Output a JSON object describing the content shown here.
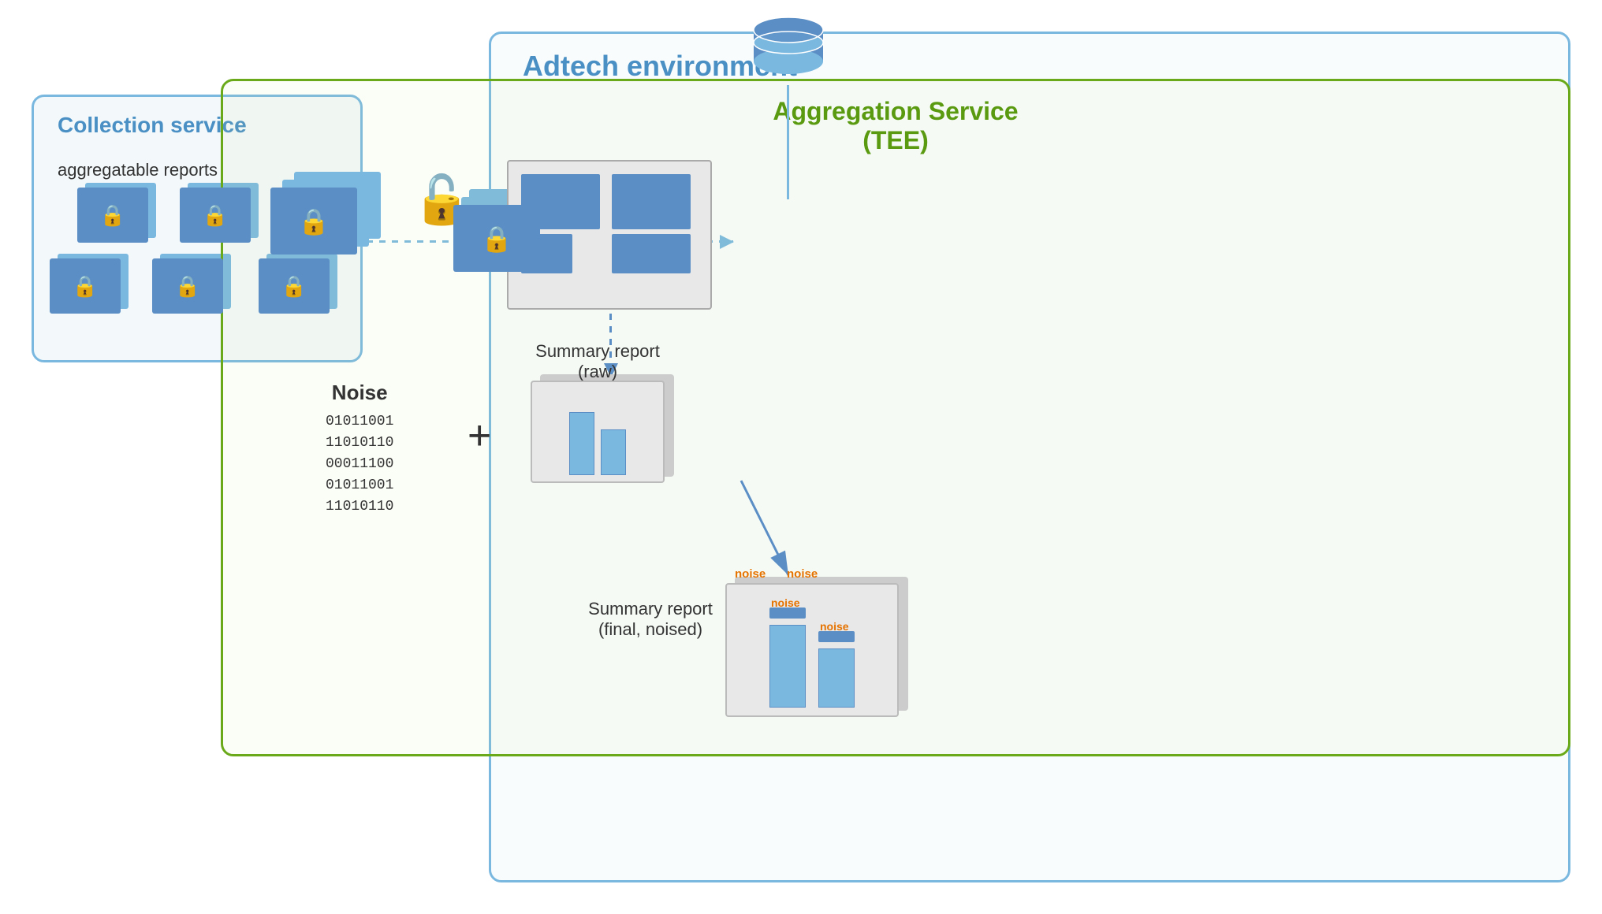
{
  "adtech": {
    "label": "Adtech environment"
  },
  "collection_service": {
    "label": "Collection service",
    "sub_label": "aggregatable reports"
  },
  "aggregation_service": {
    "label": "Aggregation Service",
    "tee_label": "(TEE)"
  },
  "noise": {
    "label": "Noise",
    "binary": [
      "01011001",
      "11010110",
      "00011100",
      "01011001",
      "11010110"
    ]
  },
  "summary_raw": {
    "label": "Summary report",
    "sublabel": "(raw)"
  },
  "summary_final": {
    "label": "Summary report",
    "sublabel": "(final, noised)"
  },
  "noise_tag1": "noise",
  "noise_tag2": "noise",
  "colors": {
    "blue_border": "#7ab8e0",
    "green_border": "#6aaa1a",
    "blue_fill": "#5b8ec4",
    "light_blue": "#aed6f1",
    "lock_color": "#f0a500",
    "adtech_blue": "#4a90c4",
    "aggregation_green": "#5a9a10"
  }
}
